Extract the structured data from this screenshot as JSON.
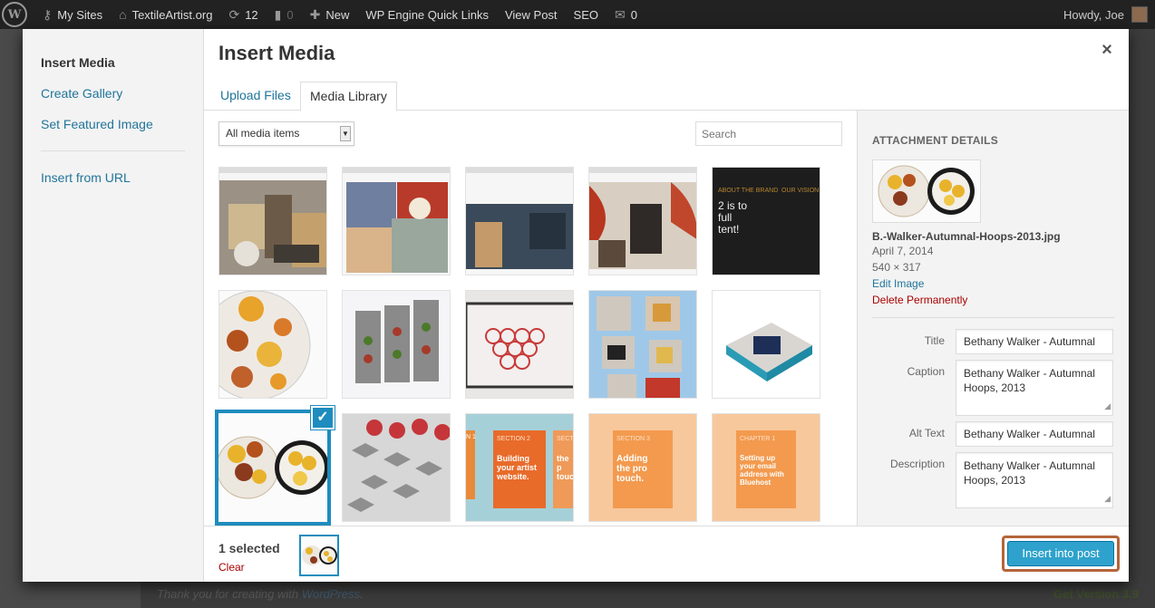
{
  "adminbar": {
    "my_sites": "My Sites",
    "site": "TextileArtist.org",
    "updates": "12",
    "comments": "0",
    "new": "New",
    "quicklinks": "WP Engine Quick Links",
    "view_post": "View Post",
    "seo": "SEO",
    "mail_count": "0",
    "howdy": "Howdy, Joe"
  },
  "backdrop": {
    "thanks": "Thank you for creating with",
    "wordpress": "WordPress",
    "period": ".",
    "get_version": "Get Version 3.9"
  },
  "menu": {
    "items": [
      {
        "label": "Insert Media",
        "active": true
      },
      {
        "label": "Create Gallery"
      },
      {
        "label": "Set Featured Image"
      },
      {
        "label": "Insert from URL"
      }
    ]
  },
  "frame": {
    "title": "Insert Media",
    "close": "×",
    "tabs": [
      "Upload Files",
      "Media Library"
    ]
  },
  "toolbar": {
    "filter_value": "All media items",
    "search_placeholder": "Search"
  },
  "details": {
    "heading": "ATTACHMENT DETAILS",
    "filename": "B.-Walker-Autumnal-Hoops-2013.jpg",
    "date": "April 7, 2014",
    "dimensions": "540 × 317",
    "edit": "Edit Image",
    "delete": "Delete Permanently",
    "fields": [
      {
        "label": "Title",
        "value": "Bethany Walker - Autumnal"
      },
      {
        "label": "Caption",
        "value": "Bethany Walker - Autumnal Hoops, 2013"
      },
      {
        "label": "Alt Text",
        "value": "Bethany Walker - Autumnal"
      },
      {
        "label": "Description",
        "value": "Bethany Walker - Autumnal Hoops, 2013"
      }
    ]
  },
  "footer": {
    "selected": "1 selected",
    "clear": "Clear",
    "insert": "Insert into post"
  },
  "thumb_text": {
    "t5": "2 is to full tent!",
    "t5_head1": "ABOUT THE BRAND",
    "t5_head2": "OUR VISION",
    "t13_label": "SECTION 2",
    "t13_text": "Building your artist website.",
    "t13_left": "N 1",
    "t13_right": "SECT",
    "t13_right_text": "the p touc",
    "t14_label": "SECTION 3",
    "t14_text": "Adding the pro touch.",
    "t15_label": "CHAPTER 1",
    "t15_text": "Setting up your email address with Bluehost"
  },
  "colors": {
    "accent": "#1e8cbe",
    "link": "#21759b",
    "delete": "#aa0000",
    "button": "#2ea2cc",
    "highlight_ring": "#b5653a"
  }
}
